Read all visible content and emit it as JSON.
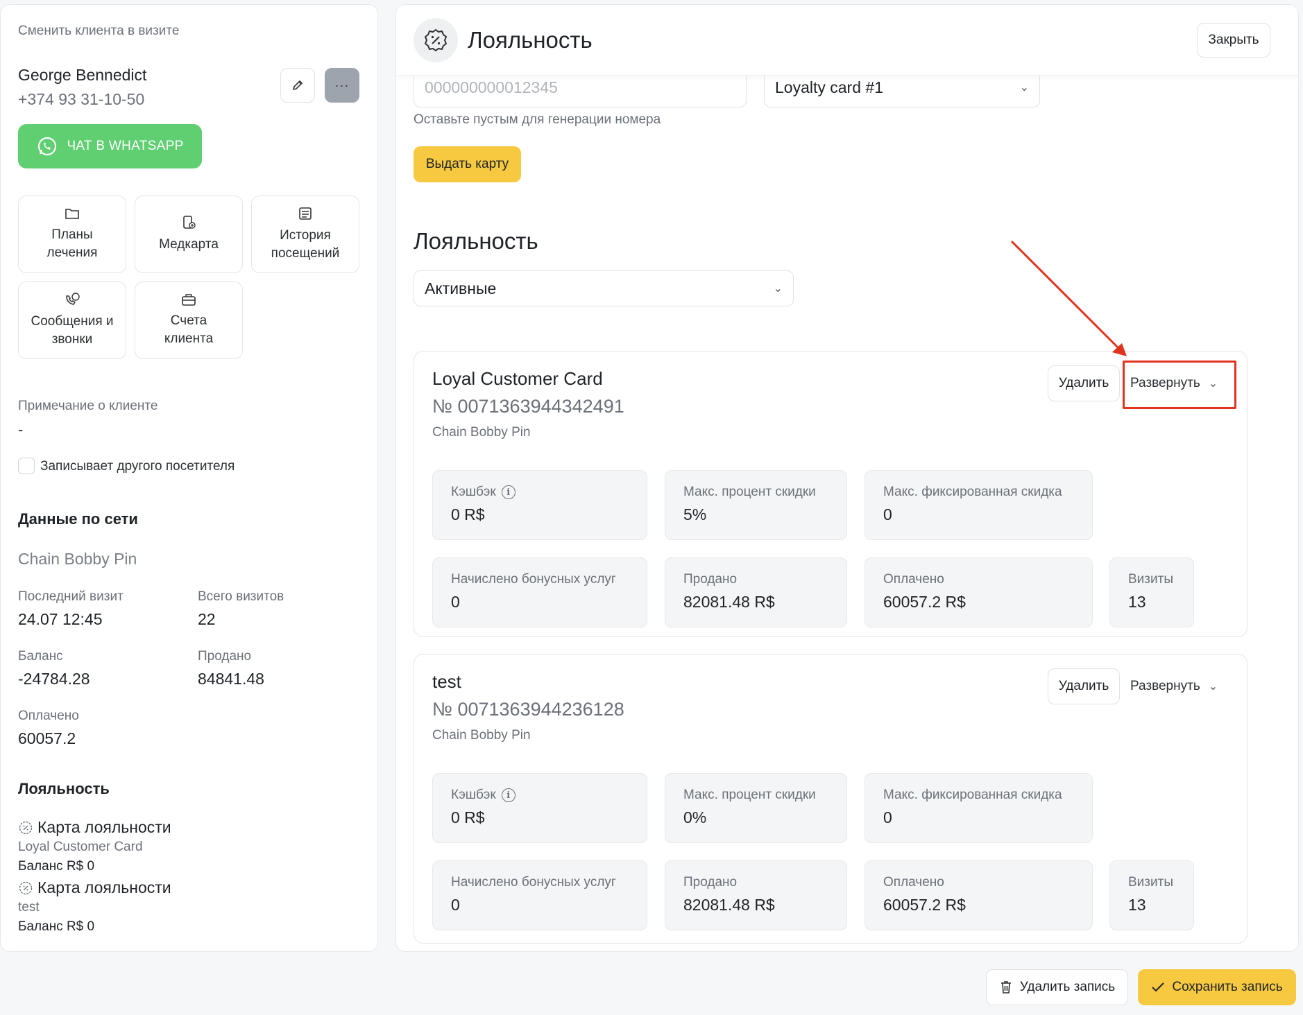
{
  "left": {
    "change_client_label": "Сменить клиента в визите",
    "client_name": "George Bennedict",
    "client_phone": "+374 93 31-10-50",
    "edit_icon": "pencil-icon",
    "more_icon": "ellipsis-icon",
    "whatsapp_label": "ЧАТ В WHATSAPP",
    "tiles": [
      {
        "label": "Планы\nлечения",
        "icon": "folder-icon"
      },
      {
        "label": "Медкарта",
        "icon": "medcard-icon"
      },
      {
        "label": "История\nпосещений",
        "icon": "history-icon"
      },
      {
        "label": "Сообщения и\nзвонки",
        "icon": "messages-icon"
      },
      {
        "label": "Счета\nклиента",
        "icon": "briefcase-icon"
      }
    ],
    "note_label": "Примечание о клиенте",
    "note_value": "-",
    "other_visitor_label": "Записывает другого посетителя",
    "network_title": "Данные по сети",
    "network_name": "Chain Bobby Pin",
    "last_visit_label": "Последний визит",
    "last_visit_value": "24.07 12:45",
    "total_visits_label": "Всего визитов",
    "total_visits_value": "22",
    "balance_label": "Баланс",
    "balance_value": "-24784.28",
    "sold_label": "Продано",
    "sold_value": "84841.48",
    "paid_label": "Оплачено",
    "paid_value": "60057.2",
    "loyalty_title": "Лояльность",
    "loyalty_items": [
      {
        "title": "Карта лояльности",
        "card": "Loyal Customer Card",
        "balance": "Баланс R$ 0"
      },
      {
        "title": "Карта лояльности",
        "card": "test",
        "balance": "Баланс R$ 0"
      }
    ]
  },
  "right": {
    "title": "Лояльность",
    "close_label": "Закрыть",
    "card_number_placeholder": "000000000012345",
    "card_type_value": "Loyalty card #1",
    "hint": "Оставьте пустым для генерации номера",
    "issue_button": "Выдать карту",
    "section_title": "Лояльность",
    "filter_value": "Активные",
    "cards": [
      {
        "name": "Loyal Customer Card",
        "number": "№ 0071363944342491",
        "chain": "Chain Bobby Pin",
        "delete_label": "Удалить",
        "expand_label": "Развернуть",
        "stats": [
          {
            "label": "Кэшбэк",
            "value": "0 R$"
          },
          {
            "label": "Макс. процент скидки",
            "value": "5%"
          },
          {
            "label": "Макс. фиксированная скидка",
            "value": "0"
          },
          {
            "label": "Начислено бонусных услуг",
            "value": "0"
          },
          {
            "label": "Продано",
            "value": "82081.48 R$"
          },
          {
            "label": "Оплачено",
            "value": "60057.2 R$"
          },
          {
            "label": "Визиты",
            "value": "13"
          }
        ]
      },
      {
        "name": "test",
        "number": "№ 0071363944236128",
        "chain": "Chain Bobby Pin",
        "delete_label": "Удалить",
        "expand_label": "Развернуть",
        "stats": [
          {
            "label": "Кэшбэк",
            "value": "0 R$"
          },
          {
            "label": "Макс. процент скидки",
            "value": "0%"
          },
          {
            "label": "Макс. фиксированная скидка",
            "value": "0"
          },
          {
            "label": "Начислено бонусных услуг",
            "value": "0"
          },
          {
            "label": "Продано",
            "value": "82081.48 R$"
          },
          {
            "label": "Оплачено",
            "value": "60057.2 R$"
          },
          {
            "label": "Визиты",
            "value": "13"
          }
        ]
      }
    ]
  },
  "footer": {
    "delete_record": "Удалить запись",
    "save_record": "Сохранить запись"
  },
  "colors": {
    "accent_yellow": "#f7c940",
    "whatsapp_green": "#5fcf72",
    "annotation_red": "#e0331f"
  }
}
